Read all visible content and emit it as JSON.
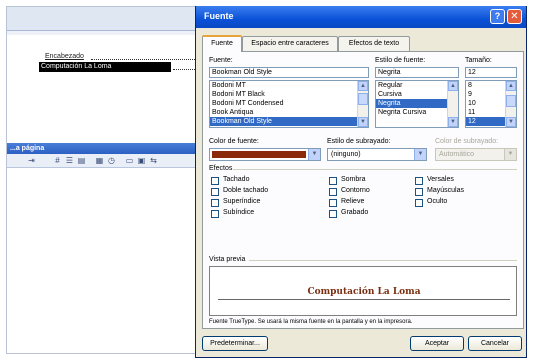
{
  "background": {
    "bookmark_text": "Encabezado",
    "selected_text": "Computación La Loma",
    "toolbar_title": "...a página",
    "toolbar_icons": [
      "indent-icon",
      "insert-icon",
      "table-icon",
      "image-icon",
      "page-icon",
      "text-icon",
      "zoom-icon"
    ]
  },
  "dialog": {
    "title": "Fuente",
    "help": "?",
    "close": "✕",
    "tabs": [
      {
        "label": "Fuente"
      },
      {
        "label": "Espacio entre caracteres"
      },
      {
        "label": "Efectos de texto"
      }
    ],
    "font": {
      "label": "Fuente:",
      "value": "Bookman Old Style",
      "items": [
        "Bodoni MT",
        "Bodoni MT Black",
        "Bodoni MT Condensed",
        "Book Antiqua",
        "Bookman Old Style"
      ],
      "selected_index": 4
    },
    "style": {
      "label": "Estilo de fuente:",
      "value": "Negrita",
      "items": [
        "Regular",
        "Cursiva",
        "Negrita",
        "Negrita Cursiva"
      ],
      "selected_index": 2
    },
    "size": {
      "label": "Tamaño:",
      "value": "12",
      "items": [
        "8",
        "9",
        "10",
        "11",
        "12"
      ],
      "selected_index": 4
    },
    "font_color": {
      "label": "Color de fuente:",
      "color": "#8b2a0a"
    },
    "underline_style": {
      "label": "Estilo de subrayado:",
      "value": "(ninguno)"
    },
    "underline_color": {
      "label": "Color de subrayado:",
      "value": "Automático"
    },
    "effects": {
      "label": "Efectos",
      "column1": [
        "Tachado",
        "Doble tachado",
        "Superíndice",
        "Subíndice"
      ],
      "column2": [
        "Sombra",
        "Contorno",
        "Relieve",
        "Grabado"
      ],
      "column3": [
        "Versales",
        "Mayúsculas",
        "Oculto"
      ]
    },
    "preview": {
      "label": "Vista previa",
      "text": "Computación La Loma",
      "note": "Fuente TrueType. Se usará la misma fuente en la pantalla y en la impresora."
    },
    "buttons": {
      "default": "Predeterminar...",
      "ok": "Aceptar",
      "cancel": "Cancelar"
    }
  }
}
